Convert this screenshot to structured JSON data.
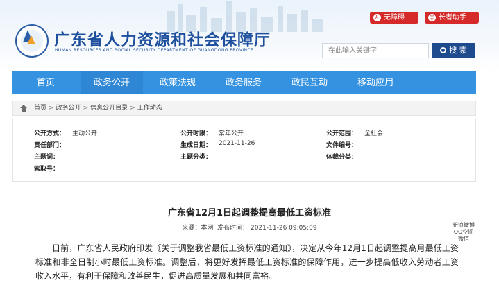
{
  "header": {
    "site_title": "广东省人力资源和社会保障厅",
    "site_subtitle": "HUMAN RESOURCES AND SOCIAL SECURITY DEPARTMENT OF GUANGDONG PROVINCE",
    "tools": {
      "accessibility": "无障碍",
      "elder_mode": "长者助手"
    },
    "search": {
      "placeholder": "在此输入关键字",
      "button": "搜 索"
    },
    "colors": {
      "brand_blue": "#1d4f9c",
      "tool_red": "#d62929"
    }
  },
  "nav": {
    "items": [
      {
        "label": "首页"
      },
      {
        "label": "政务公开"
      },
      {
        "label": "政策法规"
      },
      {
        "label": "政务服务"
      },
      {
        "label": "政民互动"
      },
      {
        "label": "移动应用"
      }
    ],
    "color": "#3592e0"
  },
  "breadcrumb": {
    "items": [
      "首页",
      "政务公开",
      "信息公开目录",
      "工作动态"
    ],
    "separator": ">"
  },
  "meta": {
    "public_mode_label": "公开方式：",
    "public_mode_value": "主动公开",
    "public_time_label": "公开时限：",
    "public_time_value": "常年公开",
    "public_scope_label": "公开范围：",
    "public_scope_value": "全社会",
    "dept_label": "责任部门：",
    "dept_value": "",
    "gen_date_label": "生成日期：",
    "gen_date_value": "2021-11-26",
    "doc_no_label": "文件编号：",
    "doc_no_value": "",
    "subject_label": "主题词：",
    "subject_cat_label": "主题分类：",
    "genre_label": "体裁分类：",
    "index_label": "索取号："
  },
  "article": {
    "title": "广东省12月1日起调整提高最低工资标准",
    "source": "来源：本网",
    "published": "发布时间：  2021-11-26 09:05:09",
    "share": [
      "新浪微博",
      "QQ空间",
      "微信"
    ],
    "body": "日前，广东省人民政府印发《关于调整我省最低工资标准的通知》，决定从今年12月1日起调整提高月最低工资标准和非全日制小时最低工资标准。调整后，将更好发挥最低工资标准的保障作用，进一步提高低收入劳动者工资收入水平，有利于保障和改善民生，促进高质量发展和共同富裕。"
  }
}
